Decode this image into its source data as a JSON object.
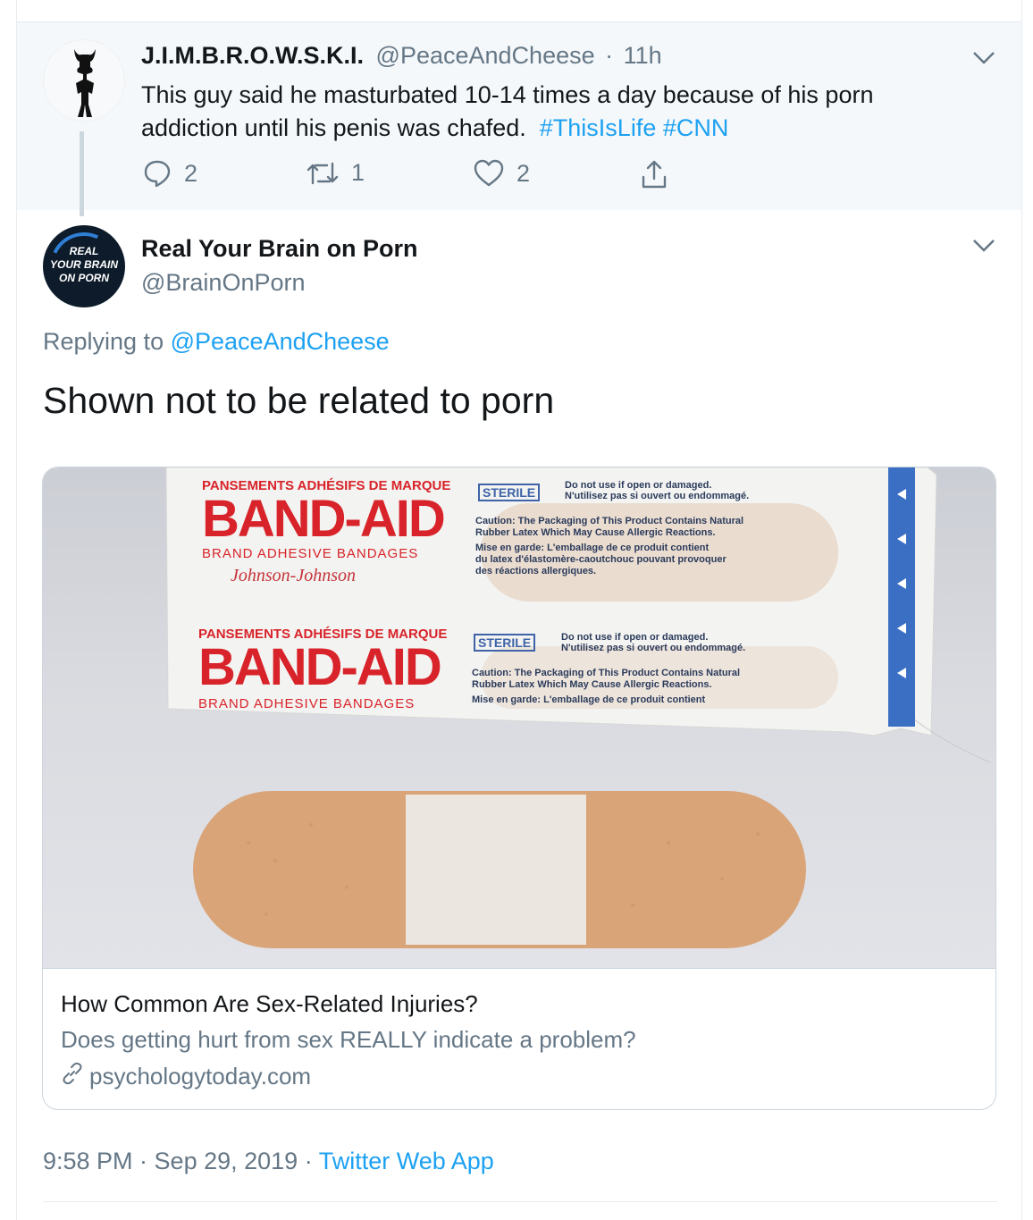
{
  "parent_tweet": {
    "name": "J.I.M.B.R.O.W.S.K.I.",
    "handle": "@PeaceAndCheese",
    "separator": "·",
    "time": "11h",
    "text": "This guy said he masturbated 10-14 times a day because of his porn addiction until his penis was chafed.",
    "hashtags": [
      "#ThisIsLife",
      "#CNN"
    ],
    "reply_count": "2",
    "retweet_count": "1",
    "like_count": "2"
  },
  "main_tweet": {
    "avatar_text": [
      "REAL",
      "YOUR BRAIN",
      "ON PORN"
    ],
    "name": "Real Your Brain on Porn",
    "handle": "@BrainOnPorn",
    "replying_prefix": "Replying to",
    "replying_to": "@PeaceAndCheese",
    "text": "Shown not to be related to porn",
    "card": {
      "image_text": {
        "pansements": "PANSEMENTS ADHÉSIFS DE MARQUE",
        "brand": "BAND-AID",
        "brand_sub": "BRAND ADHESIVE BANDAGES",
        "maker": "Johnson-Johnson",
        "sterile": "STERILE",
        "warn1": "Do not use if open or damaged.",
        "warn1_fr": "N'utilisez pas si ouvert ou endommagé.",
        "caution1": "Caution: The Packaging of This Product Contains Natural",
        "caution2": "Rubber Latex Which May Cause Allergic Reactions.",
        "mise1": "Mise en garde: L'emballage de ce produit contient",
        "mise2": "du latex d'élastomère-caoutchouc pouvant provoquer",
        "mise3": "des réactions allergiques."
      },
      "title": "How Common Are Sex-Related Injuries?",
      "description": "Does getting hurt from sex REALLY indicate a problem?",
      "domain": "psychologytoday.com"
    },
    "timestamp": "9:58 PM · Sep 29, 2019 ·",
    "source": "Twitter Web App"
  },
  "icons": {
    "reply": "reply-icon",
    "retweet": "retweet-icon",
    "like": "heart-icon",
    "share": "share-icon",
    "caret": "chevron-down-icon",
    "link": "link-icon"
  },
  "colors": {
    "accent": "#1da1f2",
    "secondary_text": "#657786",
    "parent_bg": "#f5f8fa",
    "brand_red": "#d8232a"
  }
}
